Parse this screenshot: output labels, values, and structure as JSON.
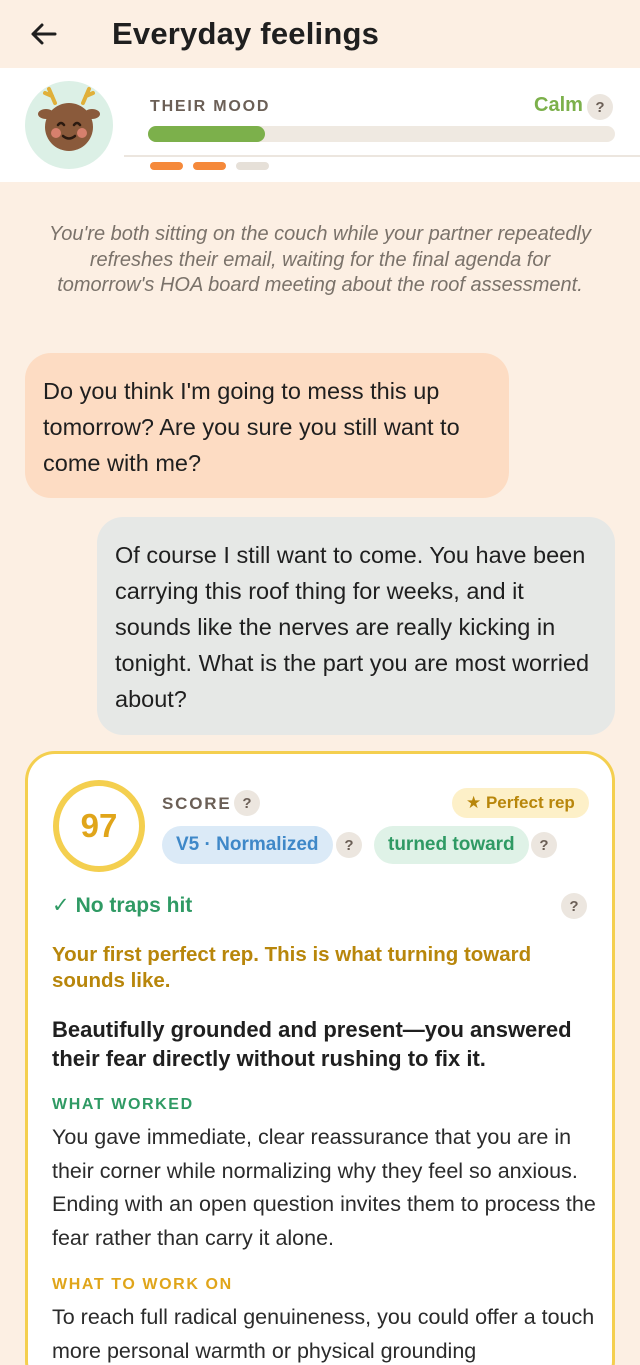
{
  "header": {
    "title": "Everyday feelings",
    "back_icon": "arrow-left-icon"
  },
  "mood": {
    "label": "THEIR MOOD",
    "value": "Calm",
    "level": 0.25,
    "help": "?",
    "accent_color": "#7cb04b",
    "dots": [
      "#f5893a",
      "#f5893a",
      "#e6e0d8"
    ]
  },
  "scene": {
    "text": "You're both sitting on the couch while your partner repeatedly refreshes their email, waiting for the final agenda for tomorrow's HOA board meeting about the roof assessment."
  },
  "messages": {
    "partner": "Do you think I'm going to mess this up tomorrow? Are you sure you still want to come with me?",
    "user": "Of course I still want to come. You have been carrying this roof thing for weeks, and it sounds like the nerves are really kicking in tonight. What is the part you are most worried about?"
  },
  "score_card": {
    "score": "97",
    "score_label": "SCORE",
    "help": "?",
    "perfect_badge": "★ Perfect rep",
    "version_pill": "V5 · Normalized",
    "category_pill": "turned toward",
    "traps": "No traps hit",
    "traps_check": "✓",
    "first_perfect": "Your first perfect rep. This is what turning toward sounds like.",
    "headline": "Beautifully grounded and present—you answered their fear directly without rushing to fix it.",
    "worked_label": "WHAT WORKED",
    "worked_text": "You gave immediate, clear reassurance that you are in their corner while normalizing why they feel so anxious. Ending with an open question invites them to process the fear rather than carry it alone.",
    "work_on_label": "WHAT TO WORK ON",
    "work_on_text": "To reach full radical genuineness, you could offer a touch more personal warmth or physical grounding"
  }
}
